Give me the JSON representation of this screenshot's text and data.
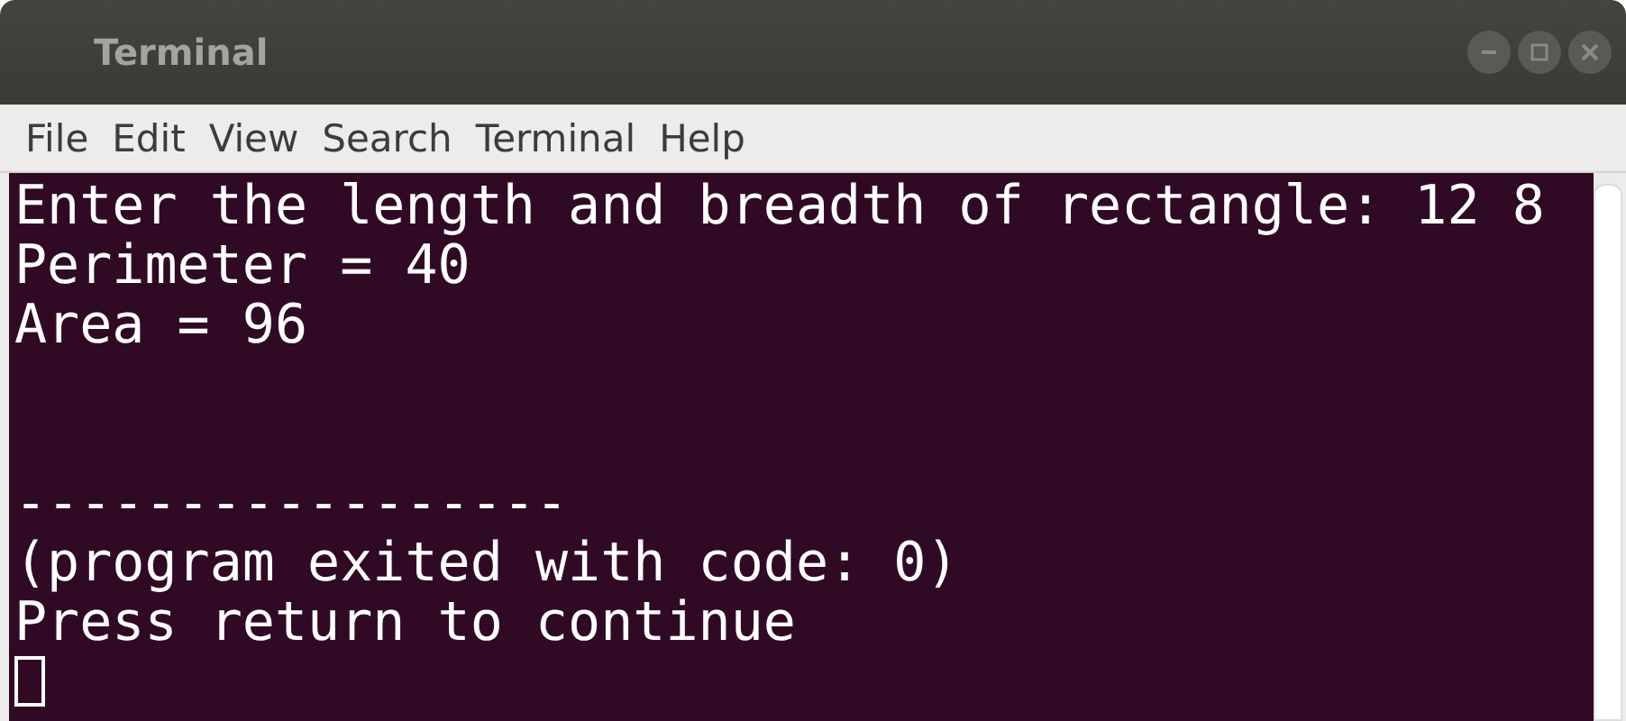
{
  "window": {
    "title": "Terminal"
  },
  "menu": [
    {
      "label": "File"
    },
    {
      "label": "Edit"
    },
    {
      "label": "View"
    },
    {
      "label": "Search"
    },
    {
      "label": "Terminal"
    },
    {
      "label": "Help"
    }
  ],
  "terminal": {
    "output": [
      "Enter the length and breadth of rectangle: 12 8",
      "Perimeter = 40",
      "Area = 96"
    ],
    "separator": "-----------------",
    "footer": [
      "(program exited with code: 0)",
      "Press return to continue"
    ]
  }
}
